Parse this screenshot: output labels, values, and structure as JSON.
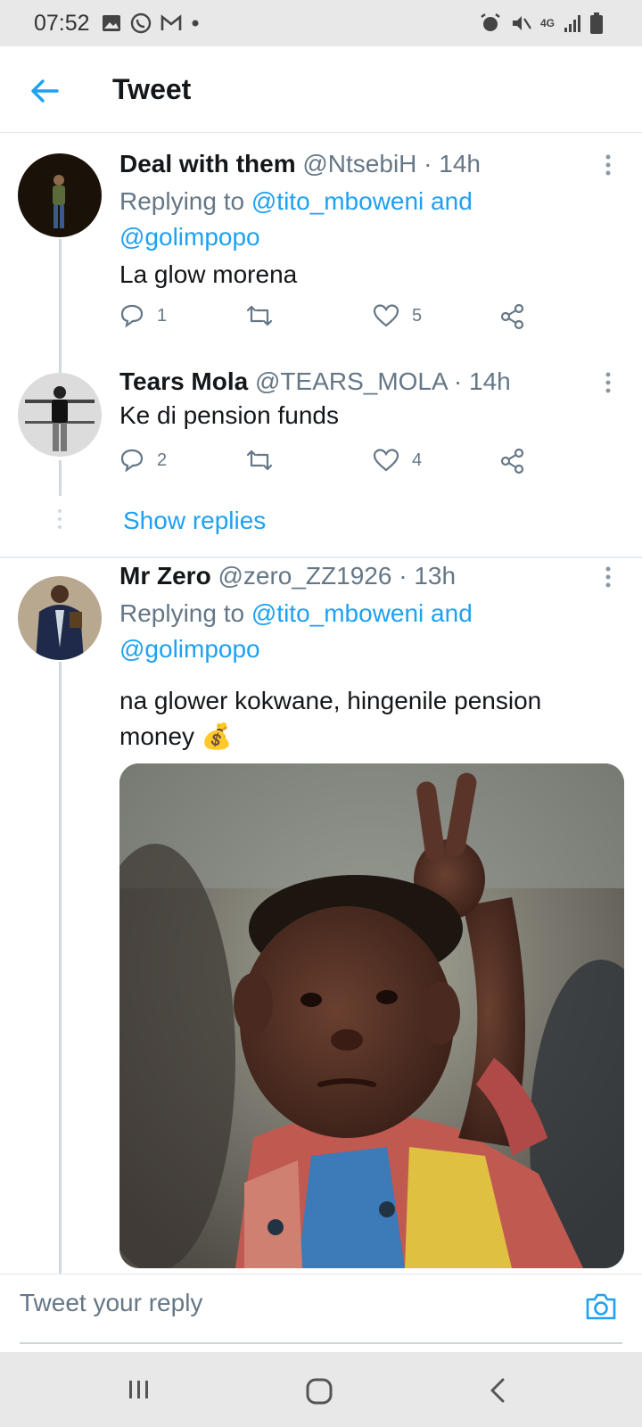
{
  "status_bar": {
    "time": "07:52",
    "left_icons": [
      "image-icon",
      "whatsapp-icon",
      "gmail-icon",
      "dot-icon"
    ],
    "right_icons": [
      "alarm-icon",
      "mute-icon",
      "4g-icon",
      "signal-icon",
      "battery-icon"
    ],
    "network_label": "4G"
  },
  "header": {
    "title": "Tweet",
    "accent_color": "#1da1f2"
  },
  "tweets": [
    {
      "name": "Deal with them",
      "handle": "@NtsebiH",
      "time": "· 14h",
      "replying_prefix": "Replying to",
      "replying_mentions_line1": "@tito_mboweni and",
      "replying_mentions_line2": "@golimpopo",
      "text": "La glow morena",
      "replies": "1",
      "retweets": "",
      "likes": "5"
    },
    {
      "name": "Tears Mola",
      "handle": "@TEARS_MOLA",
      "time": "· 14h",
      "text": "Ke di pension funds",
      "replies": "2",
      "retweets": "",
      "likes": "4",
      "show_replies": "Show replies"
    },
    {
      "name": "Mr Zero",
      "handle": "@zero_ZZ1926",
      "time": "· 13h",
      "replying_prefix": "Replying to",
      "replying_mentions_line1": "@tito_mboweni and",
      "replying_mentions_line2": "@golimpopo",
      "text_line1": "na glower kokwane, hingenile pension",
      "text_line2": "money",
      "emoji": "💰",
      "media": "photo-image"
    }
  ],
  "composer": {
    "placeholder": "Tweet your reply"
  },
  "nav_bar": {
    "buttons": [
      "recents-icon",
      "home-icon",
      "back-icon"
    ]
  }
}
